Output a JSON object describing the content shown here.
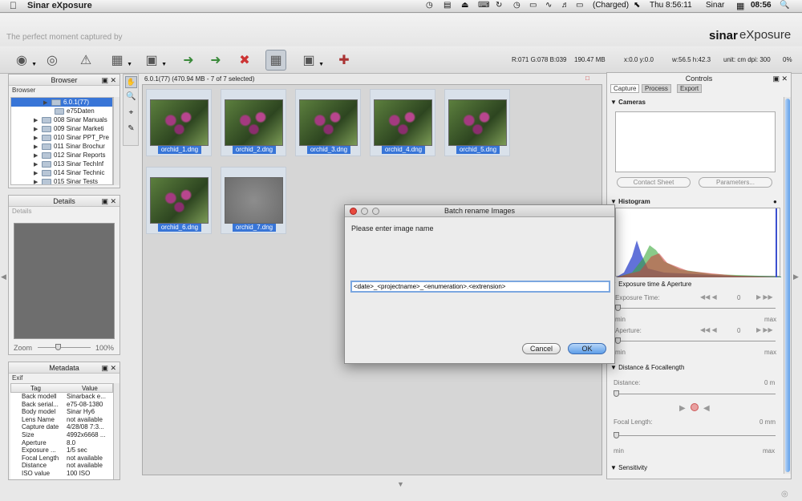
{
  "menubar": {
    "app_name": "Sinar eXposure",
    "battery": "(Charged)",
    "clock": "Thu 8:56:11",
    "user": "Sinar",
    "time_box": "08:56"
  },
  "header": {
    "tagline": "The perfect moment captured by",
    "logo_sinar": "sinar",
    "logo_exposure": "eXposure"
  },
  "status": {
    "rgb": "R:071 G:078 B:039",
    "size": "190.47 MB",
    "xy": "x:0.0 y:0.0",
    "wh": "w:56.5 h:42.3",
    "unit": "unit: cm dpi: 300",
    "pct": "0%"
  },
  "browser": {
    "title": "Browser",
    "subtab": "Browser",
    "items": [
      {
        "label": "6.0.1(77)",
        "selected": true
      },
      {
        "label": "e75Daten"
      },
      {
        "label": "008 Sinar Manuals"
      },
      {
        "label": "009 Sinar Marketi"
      },
      {
        "label": "010 Sinar PPT_Pre"
      },
      {
        "label": "011 Sinar Brochur"
      },
      {
        "label": "012 Sinar Reports"
      },
      {
        "label": "013 Sinar TechInf"
      },
      {
        "label": "014 Sinar Technic"
      },
      {
        "label": "015 Sinar Tests"
      }
    ]
  },
  "details": {
    "title": "Details",
    "subtab": "Details",
    "zoom_label": "Zoom",
    "zoom_value": "100%"
  },
  "metadata": {
    "title": "Metadata",
    "subtab": "Exif",
    "col_tag": "Tag",
    "col_value": "Value",
    "rows": [
      {
        "tag": "Back modell",
        "value": "Sinarback e..."
      },
      {
        "tag": "Back serial...",
        "value": "e75-08-1380"
      },
      {
        "tag": "Body model",
        "value": "Sinar Hy6"
      },
      {
        "tag": "Lens Name",
        "value": "not available"
      },
      {
        "tag": "Capture date",
        "value": "4/28/08 7:3..."
      },
      {
        "tag": "Size",
        "value": "4992x6668 ..."
      },
      {
        "tag": "Aperture",
        "value": "8.0"
      },
      {
        "tag": "Exposure ...",
        "value": "1/5 sec"
      },
      {
        "tag": "Focal Length",
        "value": "not available"
      },
      {
        "tag": "Distance",
        "value": "not available"
      },
      {
        "tag": "ISO value",
        "value": "100 ISO"
      }
    ]
  },
  "grid": {
    "header": "6.0.1(77) (470.94 MB - 7 of 7 selected)",
    "thumbs": [
      {
        "name": "orchid_1.dng"
      },
      {
        "name": "orchid_2.dng"
      },
      {
        "name": "orchid_3.dng"
      },
      {
        "name": "orchid_4.dng"
      },
      {
        "name": "orchid_5.dng"
      },
      {
        "name": "orchid_6.dng"
      },
      {
        "name": "orchid_7.dng"
      }
    ]
  },
  "dialog": {
    "title": "Batch rename Images",
    "prompt": "Please enter image name",
    "input_value": "<date>_<projectname>_<enumeration>.<extrension>",
    "cancel": "Cancel",
    "ok": "OK"
  },
  "controls": {
    "title": "Controls",
    "tabs": [
      "Capture",
      "Process",
      "Export"
    ],
    "cameras": "Cameras",
    "contact_sheet": "Contact Sheet",
    "parameters": "Parameters...",
    "histogram": "Histogram",
    "exposure_section": "Exposure time & Aperture",
    "exposure_time": "Exposure Time:",
    "exposure_val": "0",
    "aperture": "Aperture:",
    "aperture_val": "0",
    "min": "min",
    "max": "max",
    "distance_section": "Distance & Focallength",
    "distance": "Distance:",
    "distance_val": "0 m",
    "focal": "Focal Length:",
    "focal_val": "0 mm",
    "sensitivity": "Sensitivity"
  }
}
